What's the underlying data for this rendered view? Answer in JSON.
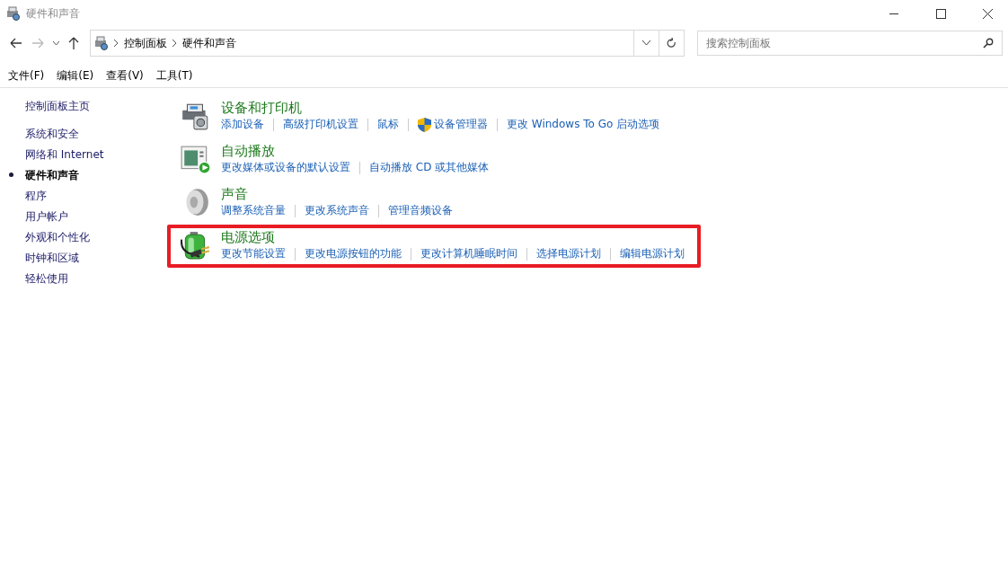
{
  "window": {
    "title": "硬件和声音"
  },
  "address_bar": {
    "path": [
      "控制面板",
      "硬件和声音"
    ]
  },
  "search": {
    "placeholder": "搜索控制面板"
  },
  "menu": [
    "文件(F)",
    "编辑(E)",
    "查看(V)",
    "工具(T)"
  ],
  "sidebar": {
    "home": "控制面板主页",
    "items": [
      {
        "label": "系统和安全",
        "selected": false
      },
      {
        "label": "网络和 Internet",
        "selected": false
      },
      {
        "label": "硬件和声音",
        "selected": true
      },
      {
        "label": "程序",
        "selected": false
      },
      {
        "label": "用户帐户",
        "selected": false
      },
      {
        "label": "外观和个性化",
        "selected": false
      },
      {
        "label": "时钟和区域",
        "selected": false
      },
      {
        "label": "轻松使用",
        "selected": false
      }
    ]
  },
  "categories": [
    {
      "kind": "printer",
      "title": "设备和打印机",
      "highlighted": false,
      "links": [
        {
          "label": "添加设备",
          "shield": false
        },
        {
          "label": "高级打印机设置",
          "shield": false
        },
        {
          "label": "鼠标",
          "shield": false
        },
        {
          "label": "设备管理器",
          "shield": true
        },
        {
          "label": "更改 Windows To Go 启动选项",
          "shield": false
        }
      ]
    },
    {
      "kind": "autoplay",
      "title": "自动播放",
      "highlighted": false,
      "links": [
        {
          "label": "更改媒体或设备的默认设置",
          "shield": false
        },
        {
          "label": "自动播放 CD 或其他媒体",
          "shield": false
        }
      ]
    },
    {
      "kind": "speaker",
      "title": "声音",
      "highlighted": false,
      "links": [
        {
          "label": "调整系统音量",
          "shield": false
        },
        {
          "label": "更改系统声音",
          "shield": false
        },
        {
          "label": "管理音频设备",
          "shield": false
        }
      ]
    },
    {
      "kind": "battery",
      "title": "电源选项",
      "highlighted": true,
      "links": [
        {
          "label": "更改节能设置",
          "shield": false
        },
        {
          "label": "更改电源按钮的功能",
          "shield": false
        },
        {
          "label": "更改计算机睡眠时间",
          "shield": false
        },
        {
          "label": "选择电源计划",
          "shield": false
        },
        {
          "label": "编辑电源计划",
          "shield": false
        }
      ]
    }
  ]
}
